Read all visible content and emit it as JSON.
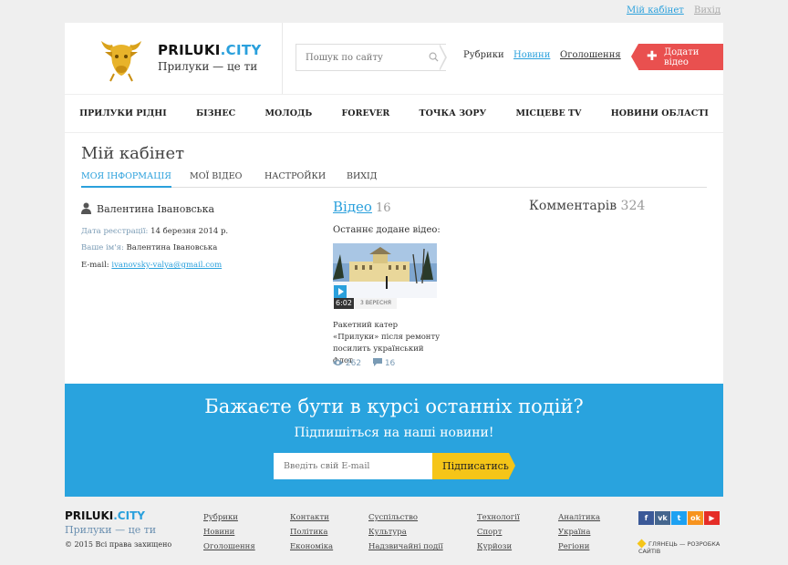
{
  "top_links": {
    "cabinet": "Мій кабінет",
    "logout": "Вихід"
  },
  "social": [
    {
      "icon": "facebook-icon",
      "glyph": "f",
      "color": "#3b5998"
    },
    {
      "icon": "vk-icon",
      "glyph": "vk",
      "color": "#45668e"
    },
    {
      "icon": "twitter-icon",
      "glyph": "t",
      "color": "#1da1f2"
    },
    {
      "icon": "odnoklassniki-icon",
      "glyph": "ok",
      "color": "#f7931e"
    },
    {
      "icon": "youtube-icon",
      "glyph": "▶",
      "color": "#e52d27"
    }
  ],
  "header": {
    "brand_main": "PRILUKI",
    "brand_tld": ".CITY",
    "tagline": "Прилуки — це ти",
    "search_placeholder": "Пошук по сайту",
    "links": [
      "Рубрики",
      "Новини",
      "Оголошення"
    ],
    "active_link": "Новини",
    "add_video": "Додати відео"
  },
  "nav": [
    "ПРИЛУКИ РІДНІ",
    "БІЗНЕС",
    "МОЛОДЬ",
    "FOREVER",
    "ТОЧКА ЗОРУ",
    "МІСЦЕВЕ TV",
    "НОВИНИ ОБЛАСТІ"
  ],
  "page_title": "Мій кабінет",
  "tabs": [
    "МОЯ ІНФОРМАЦІЯ",
    "МОЇ ВІДЕО",
    "НАСТРОЙКИ",
    "ВИХІД"
  ],
  "profile": {
    "name": "Валентина Івановська",
    "reg_label": "Дата реєстрації:",
    "reg_value": "14 березня 2014 р.",
    "name_label": "Ваше ім'я:",
    "name_value": "Валентина Івановська",
    "email_label": "E-mail:",
    "email_value": "ivanovsky-valya@gmail.com"
  },
  "videos": {
    "label": "Відео",
    "count": "16",
    "last_label": "Останнє додане відео:"
  },
  "comments": {
    "label": "Комментарів",
    "count": "324"
  },
  "last_video": {
    "duration": "6:02",
    "date": "3 ВЕРЕСНЯ",
    "title": "Ракетний катер «Прилуки» після ремонту посилить український флот",
    "views": "262",
    "comments": "16"
  },
  "subscribe": {
    "title": "Бажаєте бути в курсі останніх подій?",
    "subtitle": "Підпишіться на наші новини!",
    "placeholder": "Введіть свій E-mail",
    "button": "Підписатись"
  },
  "footer": {
    "brand_main": "PRILUKI",
    "brand_tld": ".CITY",
    "tagline": "Прилуки — це ти",
    "copyright": "© 2015 Всі права захищено",
    "columns": [
      [
        "Рубрики",
        "Новини",
        "Оголошення"
      ],
      [
        "Контакти",
        "Політика",
        "Економіка"
      ],
      [
        "Суспільство",
        "Культура",
        "Надзвичайні події"
      ],
      [
        "Технології",
        "Спорт",
        "Курйози"
      ],
      [
        "Аналітика",
        "Україна",
        "Регіони"
      ]
    ],
    "developer": "ГЛЯНЕЦЬ — РОЗРОБКА САЙТІВ"
  }
}
